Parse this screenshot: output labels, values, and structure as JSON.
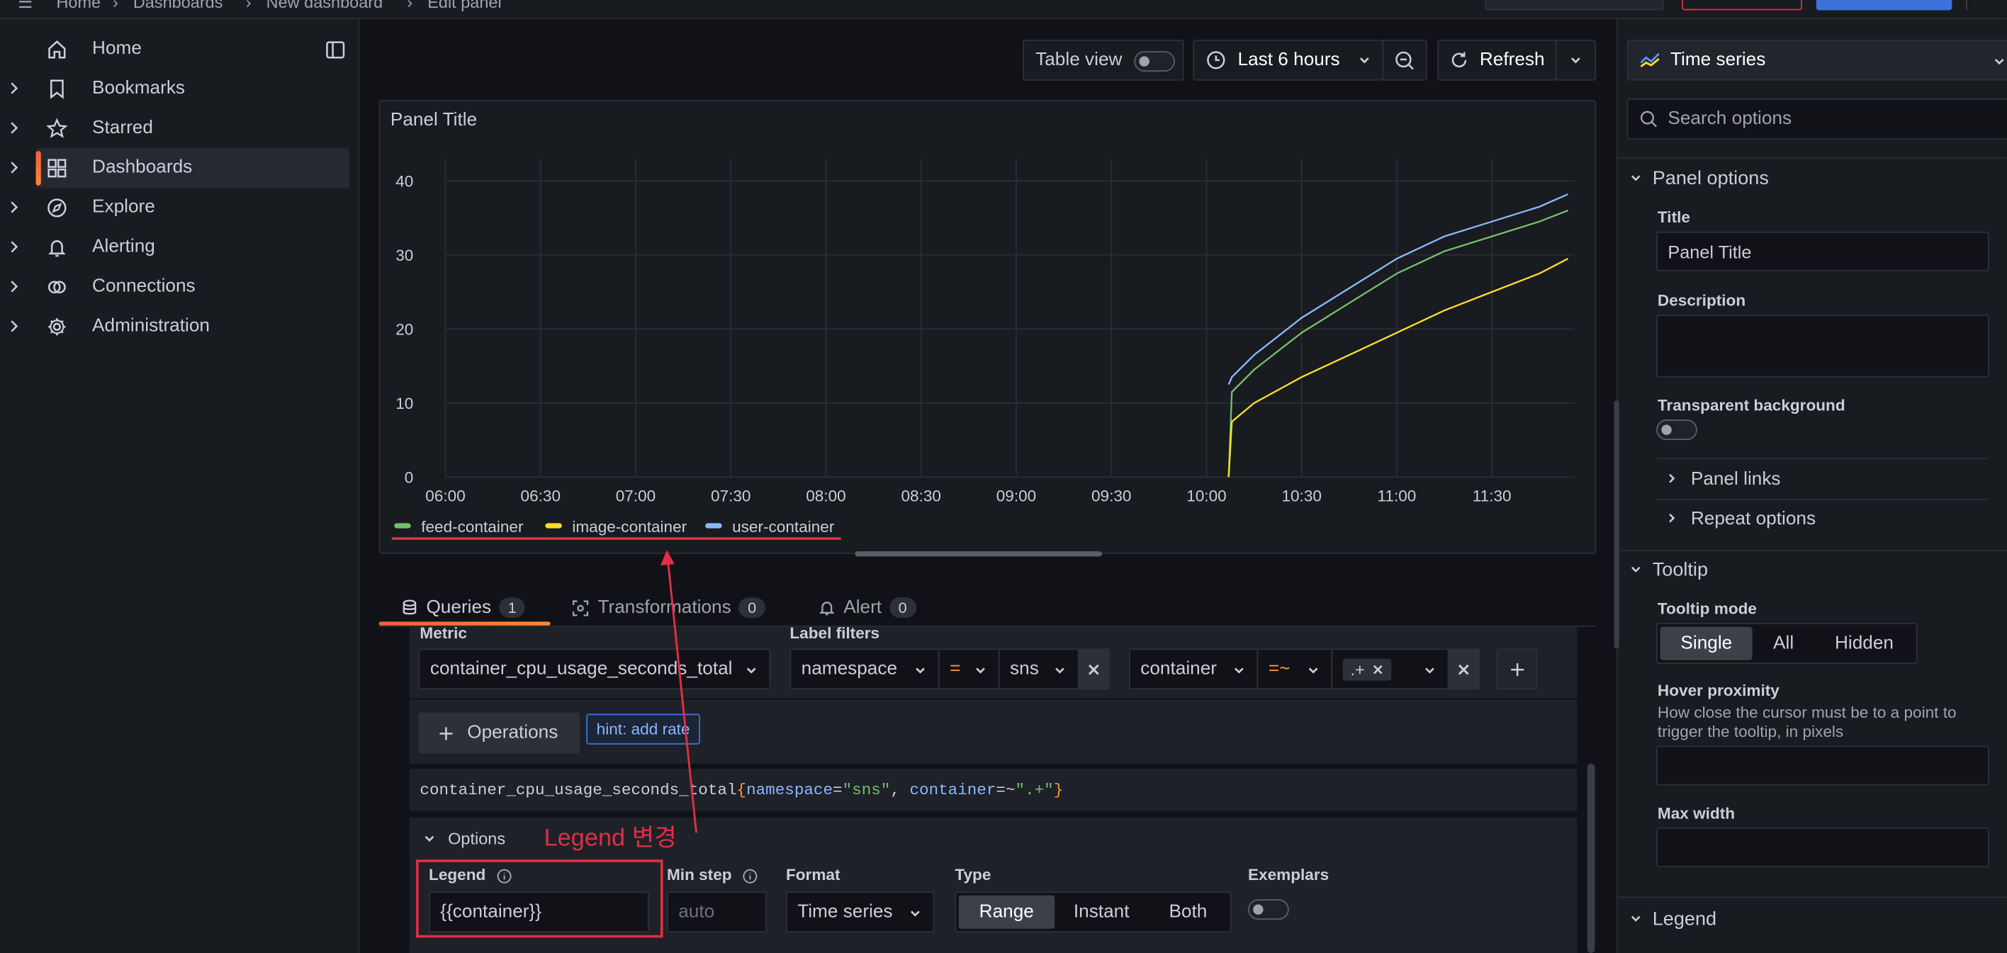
{
  "breadcrumb": [
    "Home",
    "Dashboards",
    "New dashboard",
    "Edit panel"
  ],
  "sidebar": {
    "items": [
      {
        "label": "Home",
        "icon": "home-icon",
        "expandable": false,
        "active": false
      },
      {
        "label": "Bookmarks",
        "icon": "bookmark-icon",
        "expandable": true,
        "active": false
      },
      {
        "label": "Starred",
        "icon": "star-icon",
        "expandable": true,
        "active": false
      },
      {
        "label": "Dashboards",
        "icon": "apps-icon",
        "expandable": true,
        "active": true
      },
      {
        "label": "Explore",
        "icon": "compass-icon",
        "expandable": true,
        "active": false
      },
      {
        "label": "Alerting",
        "icon": "bell-icon",
        "expandable": true,
        "active": false
      },
      {
        "label": "Connections",
        "icon": "plug-icon",
        "expandable": true,
        "active": false
      },
      {
        "label": "Administration",
        "icon": "cog-icon",
        "expandable": true,
        "active": false
      }
    ]
  },
  "toolbar": {
    "table_view_label": "Table view",
    "table_view_on": false,
    "time_range": "Last 6 hours",
    "refresh_label": "Refresh"
  },
  "panel": {
    "title": "Panel Title"
  },
  "chart_data": {
    "type": "line",
    "title": "Panel Title",
    "xlabel": "",
    "ylabel": "",
    "x_ticks": [
      "06:00",
      "06:30",
      "07:00",
      "07:30",
      "08:00",
      "08:30",
      "09:00",
      "09:30",
      "10:00",
      "10:30",
      "11:00",
      "11:30"
    ],
    "y_ticks": [
      0,
      10,
      20,
      30,
      40
    ],
    "ylim": [
      0,
      43
    ],
    "grid": true,
    "legend_position": "bottom-left",
    "x": [
      "10:07",
      "10:08",
      "10:15",
      "10:30",
      "10:45",
      "11:00",
      "11:15",
      "11:30",
      "11:45",
      "11:54"
    ],
    "series": [
      {
        "name": "feed-container",
        "color": "#73bf69",
        "values": [
          0,
          11.5,
          14.5,
          19.5,
          23.5,
          27.5,
          30.5,
          32.5,
          34.5,
          36.0
        ]
      },
      {
        "name": "image-container",
        "color": "#fade2a",
        "values": [
          0,
          7.5,
          10.0,
          13.5,
          16.5,
          19.5,
          22.5,
          25.0,
          27.5,
          29.5
        ]
      },
      {
        "name": "user-container",
        "color": "#8ab8ff",
        "values": [
          12.5,
          13.5,
          16.5,
          21.5,
          25.5,
          29.5,
          32.5,
          34.5,
          36.5,
          38.2
        ]
      }
    ]
  },
  "query_tabs": [
    {
      "label": "Queries",
      "count": "1",
      "icon": "database-icon",
      "active": true
    },
    {
      "label": "Transformations",
      "count": "0",
      "icon": "transform-icon",
      "active": false
    },
    {
      "label": "Alert",
      "count": "0",
      "icon": "bell-icon",
      "active": false
    }
  ],
  "query": {
    "metric_label": "Metric",
    "metric": "container_cpu_usage_seconds_total",
    "label_filters_label": "Label filters",
    "filters": [
      {
        "label": "namespace",
        "op": "=",
        "value": "sns"
      },
      {
        "label": "container",
        "op": "=~",
        "value": ".+"
      }
    ],
    "operations_label": "Operations",
    "hint": "hint: add rate",
    "expr_metric": "container_cpu_usage_seconds_total",
    "expr_open": "{",
    "expr_l1": "namespace",
    "expr_o1": "=",
    "expr_v1": "\"sns\"",
    "expr_sep": ", ",
    "expr_l2": "container",
    "expr_o2": "=~",
    "expr_v2": "\".+\"",
    "expr_close": "}",
    "options_label": "Options",
    "legend_label": "Legend",
    "legend_value": "{{container}}",
    "min_step_label": "Min step",
    "min_step_placeholder": "auto",
    "format_label": "Format",
    "format_value": "Time series",
    "type_label": "Type",
    "type_options": [
      "Range",
      "Instant",
      "Both"
    ],
    "type_selected": "Range",
    "exemplars_label": "Exemplars",
    "exemplars_on": false
  },
  "annotation": {
    "text": "Legend 변경",
    "color": "#e02f44"
  },
  "options_pane": {
    "visualization": "Time series",
    "search_placeholder": "Search options",
    "panel_options_label": "Panel options",
    "title_label": "Title",
    "title_value": "Panel Title",
    "description_label": "Description",
    "description_value": "",
    "transparent_label": "Transparent background",
    "panel_links_label": "Panel links",
    "repeat_options_label": "Repeat options",
    "tooltip_label": "Tooltip",
    "tooltip_mode_label": "Tooltip mode",
    "tooltip_modes": [
      "Single",
      "All",
      "Hidden"
    ],
    "tooltip_mode_selected": "Single",
    "hover_proximity_label": "Hover proximity",
    "hover_proximity_desc_1": "How close the cursor must be to a point to",
    "hover_proximity_desc_2": "trigger the tooltip, in pixels",
    "max_width_label": "Max width",
    "legend_label": "Legend"
  }
}
